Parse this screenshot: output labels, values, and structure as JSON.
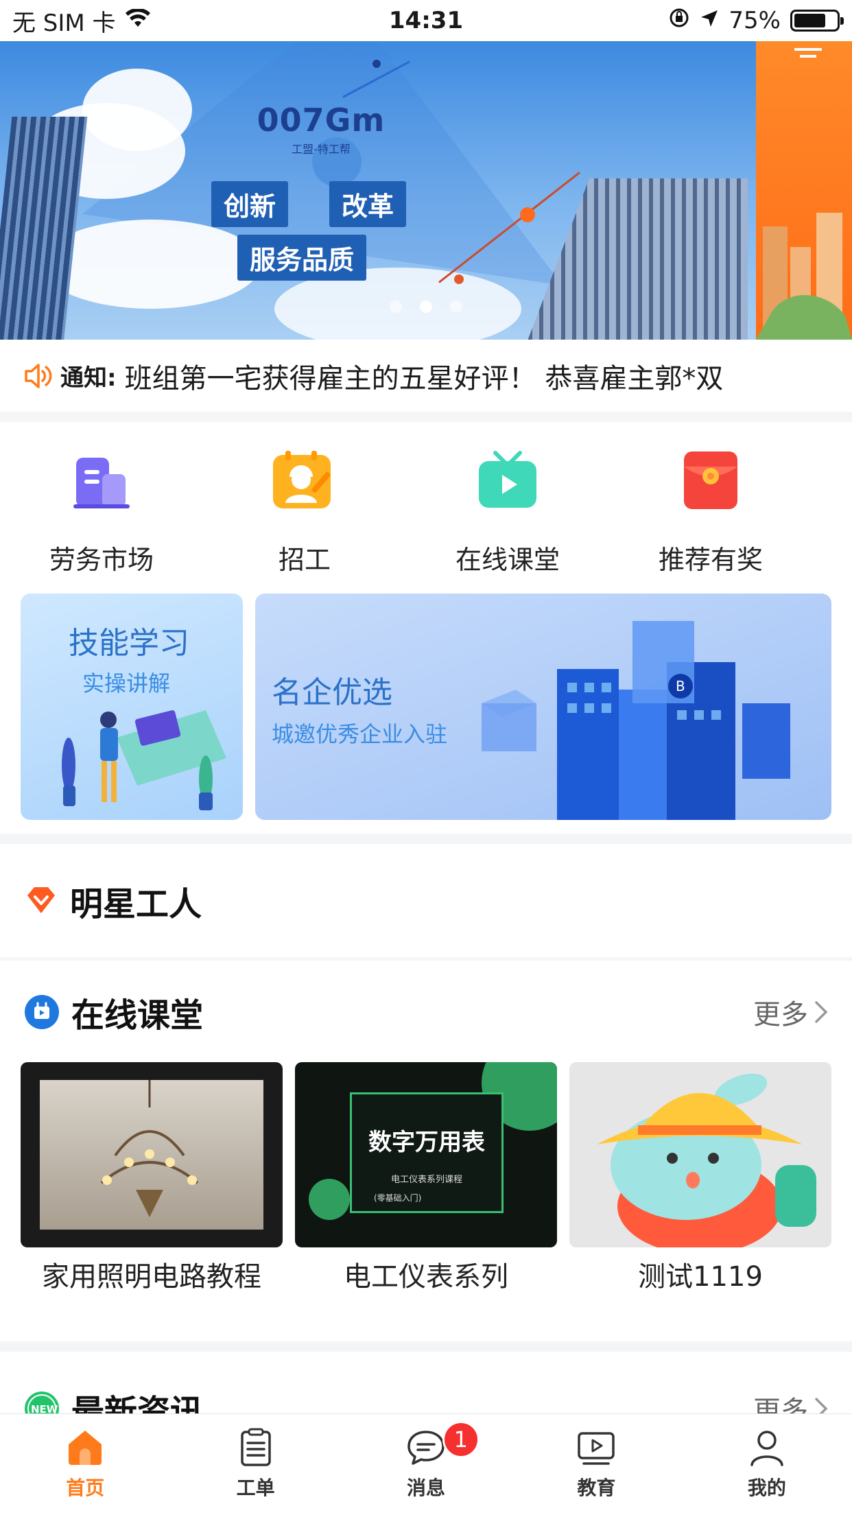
{
  "status_bar": {
    "carrier": "无 SIM 卡",
    "time": "14:31",
    "battery": "75%",
    "battery_level": 0.75
  },
  "banner": {
    "logo_main": "007Gm",
    "logo_sub": "工盟-特工帮",
    "tags": [
      "创新",
      "改革",
      "服务品质"
    ],
    "slide_count": 3,
    "active_slide": 2
  },
  "notice": {
    "icon": "speaker-icon",
    "prefix": "通知:",
    "text": "班组第一宅获得雇主的五星好评！  恭喜雇主郭*双"
  },
  "quick_nav": {
    "items": [
      {
        "label": "劳务市场",
        "icon": "building-icon",
        "color": "#7b6cf6"
      },
      {
        "label": "招工",
        "icon": "worker-icon",
        "color": "#ffb21f"
      },
      {
        "label": "在线课堂",
        "icon": "tv-play-icon",
        "color": "#3fd8b8"
      },
      {
        "label": "推荐有奖",
        "icon": "red-envelope-icon",
        "color": "#f4443b"
      }
    ]
  },
  "promos": {
    "skill": {
      "title": "技能学习",
      "subtitle": "实操讲解"
    },
    "company": {
      "title": "名企优选",
      "subtitle": "城邀优秀企业入驻"
    }
  },
  "star_workers": {
    "title": "明星工人",
    "icon": "diamond-icon"
  },
  "courses": {
    "title": "在线课堂",
    "more": "更多",
    "items": [
      {
        "title": "家用照明电路教程"
      },
      {
        "title": "电工仪表系列",
        "thumb_text": "数字万用表",
        "thumb_sub": "电工仪表系列课程",
        "thumb_sub2": "(零基础入门)"
      },
      {
        "title": "测试1119"
      }
    ]
  },
  "news": {
    "title": "最新资讯",
    "more": "更多",
    "badge": "NEW"
  },
  "tabbar": {
    "items": [
      {
        "label": "首页",
        "icon": "home-icon",
        "active": true
      },
      {
        "label": "工单",
        "icon": "clipboard-icon"
      },
      {
        "label": "消息",
        "icon": "chat-icon",
        "badge": "1"
      },
      {
        "label": "教育",
        "icon": "video-play-icon"
      },
      {
        "label": "我的",
        "icon": "user-icon"
      }
    ]
  },
  "colors": {
    "accent": "#ff7a1a",
    "badge": "#f5302f",
    "link_blue": "#2a71c8"
  }
}
